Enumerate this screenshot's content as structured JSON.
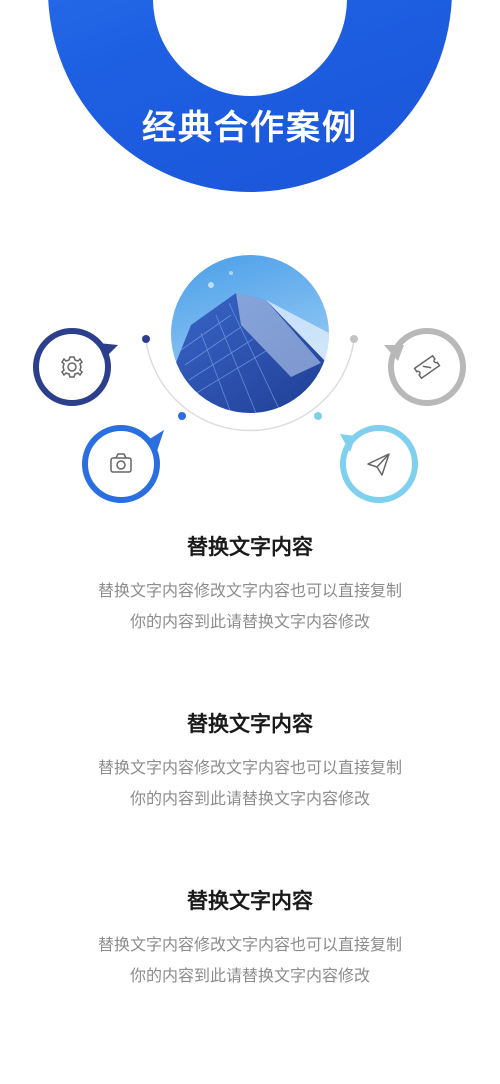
{
  "header": {
    "title": "经典合作案例"
  },
  "icons": [
    {
      "name": "gear-icon",
      "color": "#2b3f8c"
    },
    {
      "name": "camera-icon",
      "color": "#2a6fe0"
    },
    {
      "name": "ticket-icon",
      "color": "#b8b8b8"
    },
    {
      "name": "paper-plane-icon",
      "color": "#7fd0ec"
    }
  ],
  "sections": [
    {
      "title": "替换文字内容",
      "line1": "替换文字内容修改文字内容也可以直接复制",
      "line2": "你的内容到此请替换文字内容修改"
    },
    {
      "title": "替换文字内容",
      "line1": "替换文字内容修改文字内容也可以直接复制",
      "line2": "你的内容到此请替换文字内容修改"
    },
    {
      "title": "替换文字内容",
      "line1": "替换文字内容修改文字内容也可以直接复制",
      "line2": "你的内容到此请替换文字内容修改"
    }
  ]
}
